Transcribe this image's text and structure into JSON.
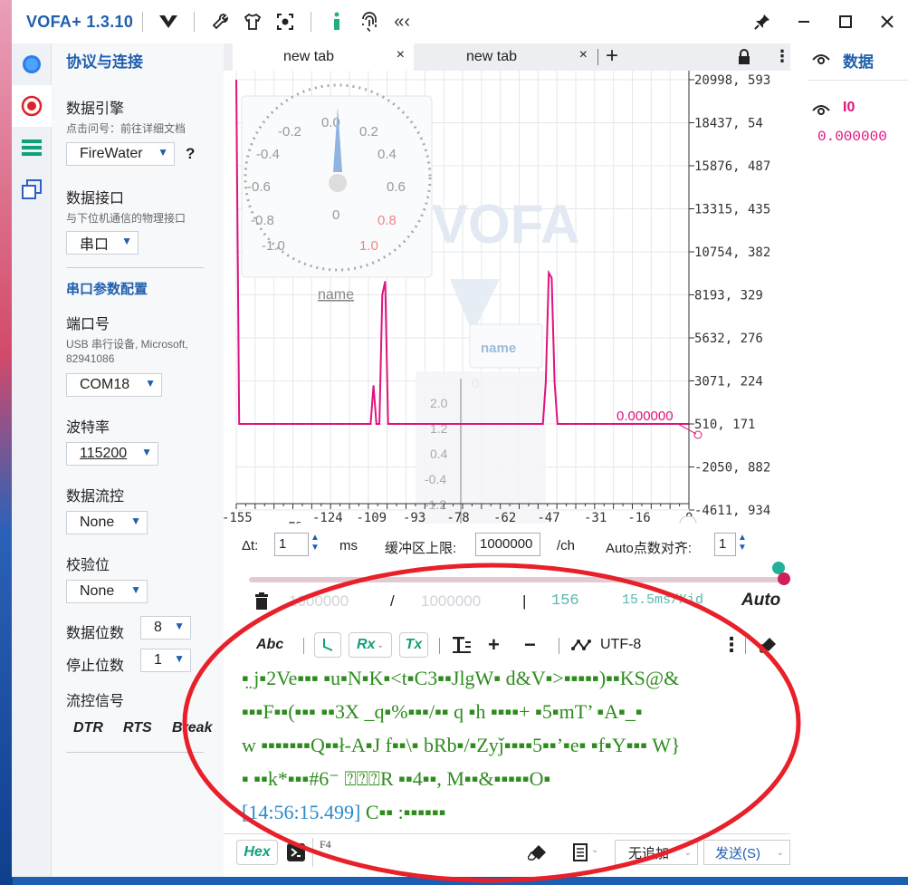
{
  "app": {
    "title": "VOFA+ 1.3.10"
  },
  "titlebar": {
    "icons": [
      "vofa-logo-icon",
      "wrench-icon",
      "shirt-icon",
      "capture-icon",
      "info-icon",
      "fingerprint-icon",
      "collapse-icon"
    ],
    "window_buttons": [
      "pin-icon",
      "minimize-icon",
      "maximize-icon",
      "close-icon"
    ]
  },
  "left_panel": {
    "heading": "协议与连接",
    "engine_label": "数据引擎",
    "engine_hint": "点击问号：前往详细文档",
    "engine_value": "FireWater",
    "engine_help": "?",
    "iface_label": "数据接口",
    "iface_hint": "与下位机通信的物理接口",
    "iface_value": "串口",
    "serial_heading": "串口参数配置",
    "port_label": "端口号",
    "port_hint_1": "USB 串行设备, Microsoft,",
    "port_hint_2": "82941086",
    "port_value": "COM18",
    "baud_label": "波特率",
    "baud_value": "115200",
    "flow_label": "数据流控",
    "flow_value": "None",
    "parity_label": "校验位",
    "parity_value": "None",
    "databits_label": "数据位数",
    "databits_value": "8",
    "stopbits_label": "停止位数",
    "stopbits_value": "1",
    "flowsig_label": "流控信号",
    "dtr": "DTR",
    "rts": "RTS",
    "brk": "Break"
  },
  "tabs": [
    {
      "label": "new tab",
      "close": "×"
    },
    {
      "label": "new tab",
      "close": "×"
    }
  ],
  "tab_add": "+",
  "plot": {
    "watermark": "VOFA",
    "dial_ticks": [
      "-0.2",
      "0.0",
      "0.2",
      "-0.4",
      "0.4",
      "-0.6",
      "0.6",
      "-0.8",
      "0.8",
      "-1.0",
      "1.0",
      "0"
    ],
    "widget_name_1": "name",
    "widget_name_2": "name",
    "slider_ticks": [
      "0",
      "2.0",
      "1.2",
      "0.4",
      "-0.4",
      "-1.2"
    ],
    "y_ticks": [
      "20998.593",
      "18437.54",
      "15876.487",
      "13315.435",
      "10754.382",
      "8193.329",
      "5632.276",
      "3071.224",
      "510.171",
      "-2050.882",
      "-4611.934"
    ],
    "x_ticks": [
      "-155",
      "-140",
      "-124",
      "-109",
      "-93",
      "-78",
      "-62",
      "-47",
      "-31",
      "-16",
      "0"
    ],
    "x_unit": "ms",
    "cursor_value": "0.000000",
    "accent": "#e0137d"
  },
  "chart_data": {
    "type": "line",
    "x": [
      -155,
      -154,
      -109,
      -108,
      -107,
      -106,
      -105,
      -104,
      -103,
      -102,
      -101,
      -100,
      -99,
      -50,
      -49,
      -48,
      -47,
      -46,
      -45,
      -44,
      -43,
      0
    ],
    "series": [
      {
        "values": [
          20998,
          510,
          510,
          2800,
          510,
          510,
          8200,
          9000,
          510,
          510,
          510,
          510,
          510,
          510,
          3000,
          9500,
          9200,
          3000,
          510,
          510,
          510,
          510
        ]
      }
    ],
    "ylim": [
      -4611.934,
      20998.593
    ],
    "xlim": [
      -155,
      0
    ],
    "yticks": [
      "20998.593",
      "18437.54",
      "15876.487",
      "13315.435",
      "10754.382",
      "8193.329",
      "5632.276",
      "3071.224",
      "510.171",
      "-2050.882",
      "-4611.934"
    ],
    "xticks": [
      "-155",
      "-140",
      "-124",
      "-109",
      "-93",
      "-78",
      "-62",
      "-47",
      "-31",
      "-16",
      "0"
    ],
    "xlabel": "ms"
  },
  "controls": {
    "dt_label": "Δt:",
    "dt_value": "1",
    "dt_unit": "ms",
    "buffer_label": "缓冲区上限:",
    "buffer_value": "1000000",
    "buffer_unit": "/ch",
    "auto_label": "Auto点数对齐:",
    "auto_value": "1"
  },
  "status": {
    "count_a": "1000000",
    "slash": "/",
    "count_b": "1000000",
    "bar": "|",
    "points": "156",
    "rate": "15.5ms/Xid",
    "auto": "Auto"
  },
  "rx_toolbar": {
    "abc": "Abc",
    "rx": "Rx",
    "tx": "Tx",
    "plus": "+",
    "minus": "−",
    "encoding": "UTF-8",
    "more": "⋮"
  },
  "terminal": {
    "line1": "▪̤ j▪2Ve▪▪▪ ▪u▪N▪K▪<t▪C3▪▪JlgW▪ d&V▪>▪▪▪▪▪)▪▪KS@&",
    "line2": "▪▪▪F▪▪(▪▪▪ ▪▪3X _q▪%▪▪▪/▪▪  q ▪h ▪▪▪▪+ ▪5▪mT’ ▪A▪_▪",
    "line3": "w ▪▪▪▪▪▪▪Q▪▪ł-A▪J f▪▪\\▪ bRb▪/▪Zyǰ▪▪▪▪5▪▪’▪e▪ ▪f▪Y▪▪▪ W}",
    "line4": "▪ ▪▪k*▪▪▪#6⁻ ⍰⍰⍰R ▪▪4▪▪, M▪▪&▪▪▪▪▪O▪",
    "timestamp": "[14:56:15.499]",
    "line5": " C▪▪ :▪▪▪▪▪▪"
  },
  "send_bar": {
    "hex": "Hex",
    "shortcut": "F4",
    "append": "无追加",
    "send": "发送(S)"
  },
  "right_panel": {
    "title": "数据",
    "channel": "I0",
    "channel_value": "0.000000"
  }
}
